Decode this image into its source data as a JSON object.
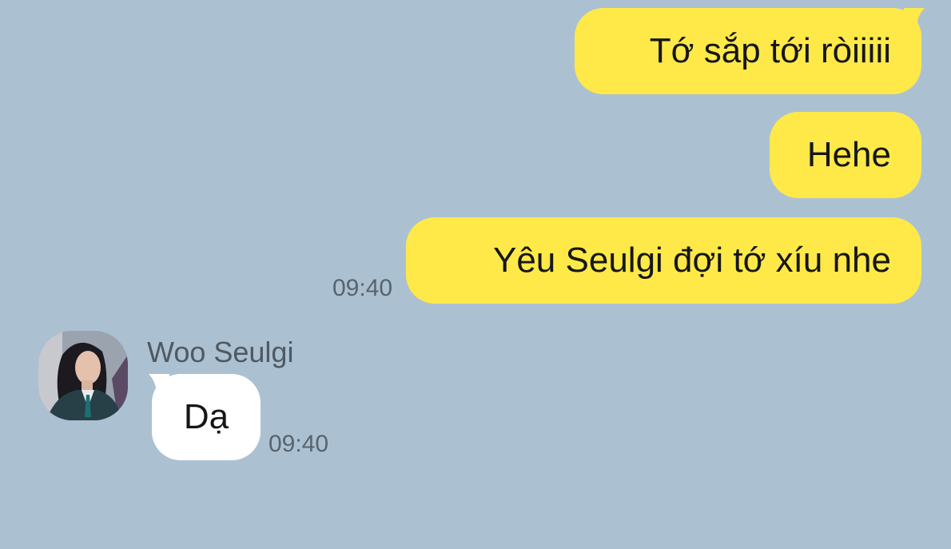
{
  "conversation": {
    "sent_messages": [
      {
        "text": "Tớ sắp tới ròiiiii"
      },
      {
        "text": "Hehe"
      },
      {
        "text": "Yêu Seulgi đợi tớ xíu nhe"
      }
    ],
    "sent_time": "09:40",
    "contact": {
      "name": "Woo Seulgi",
      "avatar_icon": "profile-photo"
    },
    "received_messages": [
      {
        "text": "Dạ"
      }
    ],
    "received_time": "09:40"
  },
  "colors": {
    "background": "#abc1d2",
    "sent_bubble": "#fee949",
    "received_bubble": "#ffffff",
    "timestamp": "#59636c"
  }
}
